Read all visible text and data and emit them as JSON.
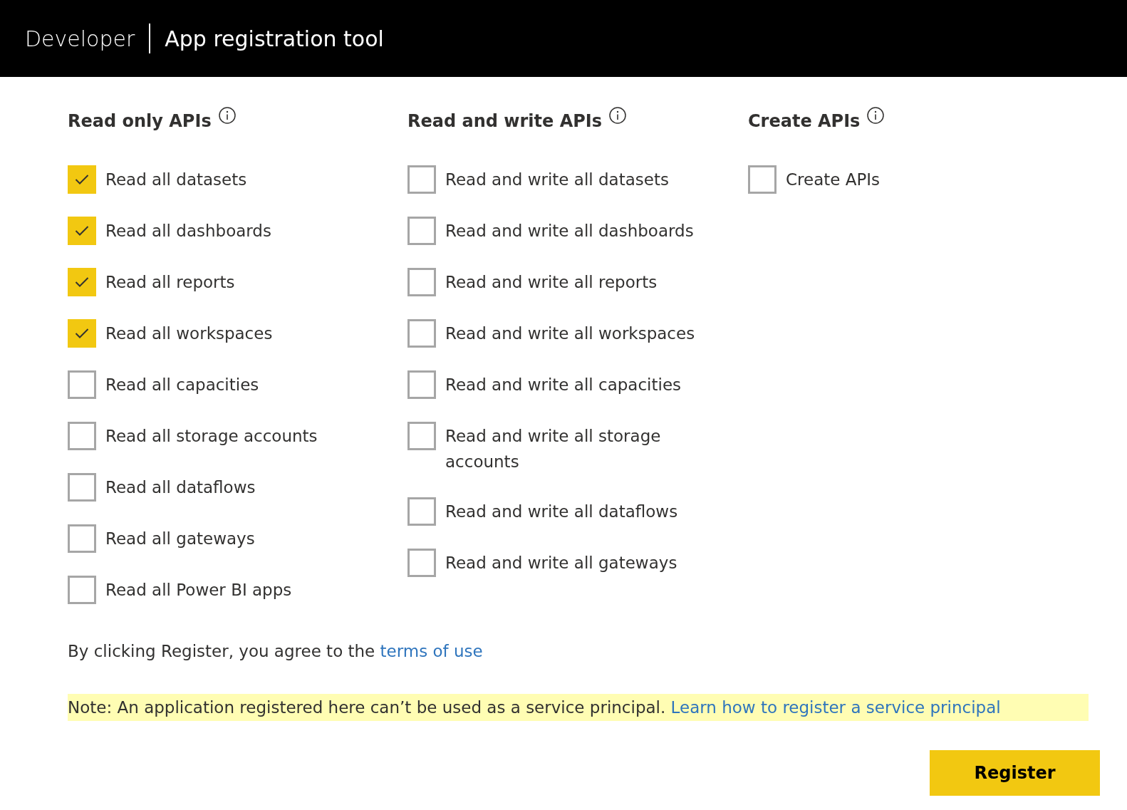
{
  "header": {
    "brand": "Developer",
    "title": "App registration tool"
  },
  "groups": [
    {
      "title": "Read only APIs",
      "items": [
        {
          "label": "Read all datasets",
          "checked": true
        },
        {
          "label": "Read all dashboards",
          "checked": true
        },
        {
          "label": "Read all reports",
          "checked": true
        },
        {
          "label": "Read all workspaces",
          "checked": true
        },
        {
          "label": "Read all capacities",
          "checked": false
        },
        {
          "label": "Read all storage accounts",
          "checked": false
        },
        {
          "label": "Read all dataflows",
          "checked": false
        },
        {
          "label": "Read all gateways",
          "checked": false
        },
        {
          "label": "Read all Power BI apps",
          "checked": false
        }
      ]
    },
    {
      "title": "Read and write APIs",
      "items": [
        {
          "label": "Read and write all datasets",
          "checked": false
        },
        {
          "label": "Read and write all dashboards",
          "checked": false
        },
        {
          "label": "Read and write all reports",
          "checked": false
        },
        {
          "label": "Read and write all workspaces",
          "checked": false
        },
        {
          "label": "Read and write all capacities",
          "checked": false
        },
        {
          "label": "Read and write all storage accounts",
          "checked": false
        },
        {
          "label": "Read and write all dataflows",
          "checked": false
        },
        {
          "label": "Read and write all gateways",
          "checked": false
        }
      ]
    },
    {
      "title": "Create APIs",
      "items": [
        {
          "label": "Create APIs",
          "checked": false
        }
      ]
    }
  ],
  "terms": {
    "text": "By clicking Register, you agree to the",
    "link": "terms of use"
  },
  "note": {
    "text": "Note: An application registered here can’t be used as a service principal.",
    "link": "Learn how to register a service principal"
  },
  "register_button": "Register"
}
